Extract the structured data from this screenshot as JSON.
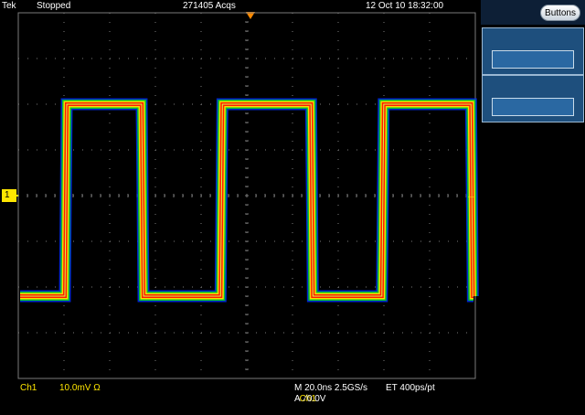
{
  "topbar": {
    "brand": "Tek",
    "status": "Stopped",
    "acquisitions": "271405 Acqs",
    "datetime": "12 Oct 10 18:32:00"
  },
  "side_panel": {
    "buttons_label": "Buttons"
  },
  "channel_marker": "1",
  "trigger_level_glyph": "←",
  "readouts": {
    "ch1_label": "Ch1",
    "ch1_scale": "10.0mV  Ω",
    "horizontal": "M 20.0ns 2.5GS/s",
    "equivalent_time": "ET 400ps/pt",
    "trigger_prefix": "A",
    "trigger_channel": "Ch1",
    "trigger_slope": "⁄",
    "trigger_level": "0.0V"
  },
  "waveform": {
    "type": "square",
    "transitions_ns": [
      -79.2,
      -45.6,
      -11.1,
      28.5,
      59.5,
      98.5
    ],
    "high_level_div": 2.0,
    "low_level_div": -2.2,
    "initial_state": "low"
  },
  "colors": {
    "trace_core": "#ff1a00",
    "trace_mid": "#ffd800",
    "trace_edge": "#00c030",
    "trace_outer": "#0030ff",
    "grid": "#7a7a7a",
    "channel": "#ffe600",
    "trigger_marker": "#ff8a00"
  }
}
